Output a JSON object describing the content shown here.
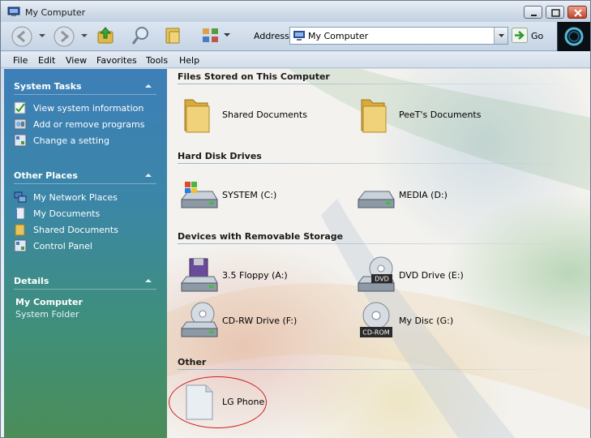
{
  "window": {
    "title": "My Computer"
  },
  "toolbar": {
    "address_label": "Address",
    "address_value": "My Computer",
    "go_label": "Go"
  },
  "menu": [
    "File",
    "Edit",
    "View",
    "Favorites",
    "Tools",
    "Help"
  ],
  "taskpane": {
    "system_tasks": {
      "heading": "System Tasks",
      "links": [
        "View system information",
        "Add or remove programs",
        "Change a setting"
      ]
    },
    "other_places": {
      "heading": "Other Places",
      "links": [
        "My Network Places",
        "My Documents",
        "Shared Documents",
        "Control Panel"
      ]
    },
    "details": {
      "heading": "Details",
      "title": "My Computer",
      "subtitle": "System Folder"
    }
  },
  "groups": [
    {
      "heading": "Files Stored on This Computer",
      "items": [
        {
          "label": "Shared Documents",
          "icon": "folder-icon"
        },
        {
          "label": "PeeT's Documents",
          "icon": "folder-icon"
        }
      ]
    },
    {
      "heading": "Hard Disk Drives",
      "items": [
        {
          "label": "SYSTEM (C:)",
          "icon": "system-drive-icon"
        },
        {
          "label": "MEDIA (D:)",
          "icon": "hard-drive-icon"
        }
      ]
    },
    {
      "heading": "Devices with Removable Storage",
      "items": [
        {
          "label": "3.5 Floppy (A:)",
          "icon": "floppy-drive-icon",
          "badge": ""
        },
        {
          "label": "DVD Drive (E:)",
          "icon": "dvd-drive-icon",
          "badge": "DVD"
        },
        {
          "label": "CD-RW Drive (F:)",
          "icon": "cd-drive-icon",
          "badge": ""
        },
        {
          "label": "My Disc (G:)",
          "icon": "cd-rom-disc-icon",
          "badge": "CD-ROM"
        }
      ]
    },
    {
      "heading": "Other",
      "items": [
        {
          "label": "LG Phone",
          "icon": "device-file-icon"
        }
      ]
    }
  ],
  "colors": {
    "highlight_ring": "#cc1f1f",
    "taskpane_top": "#3d7fb8",
    "taskpane_bottom": "#4b8d58"
  }
}
